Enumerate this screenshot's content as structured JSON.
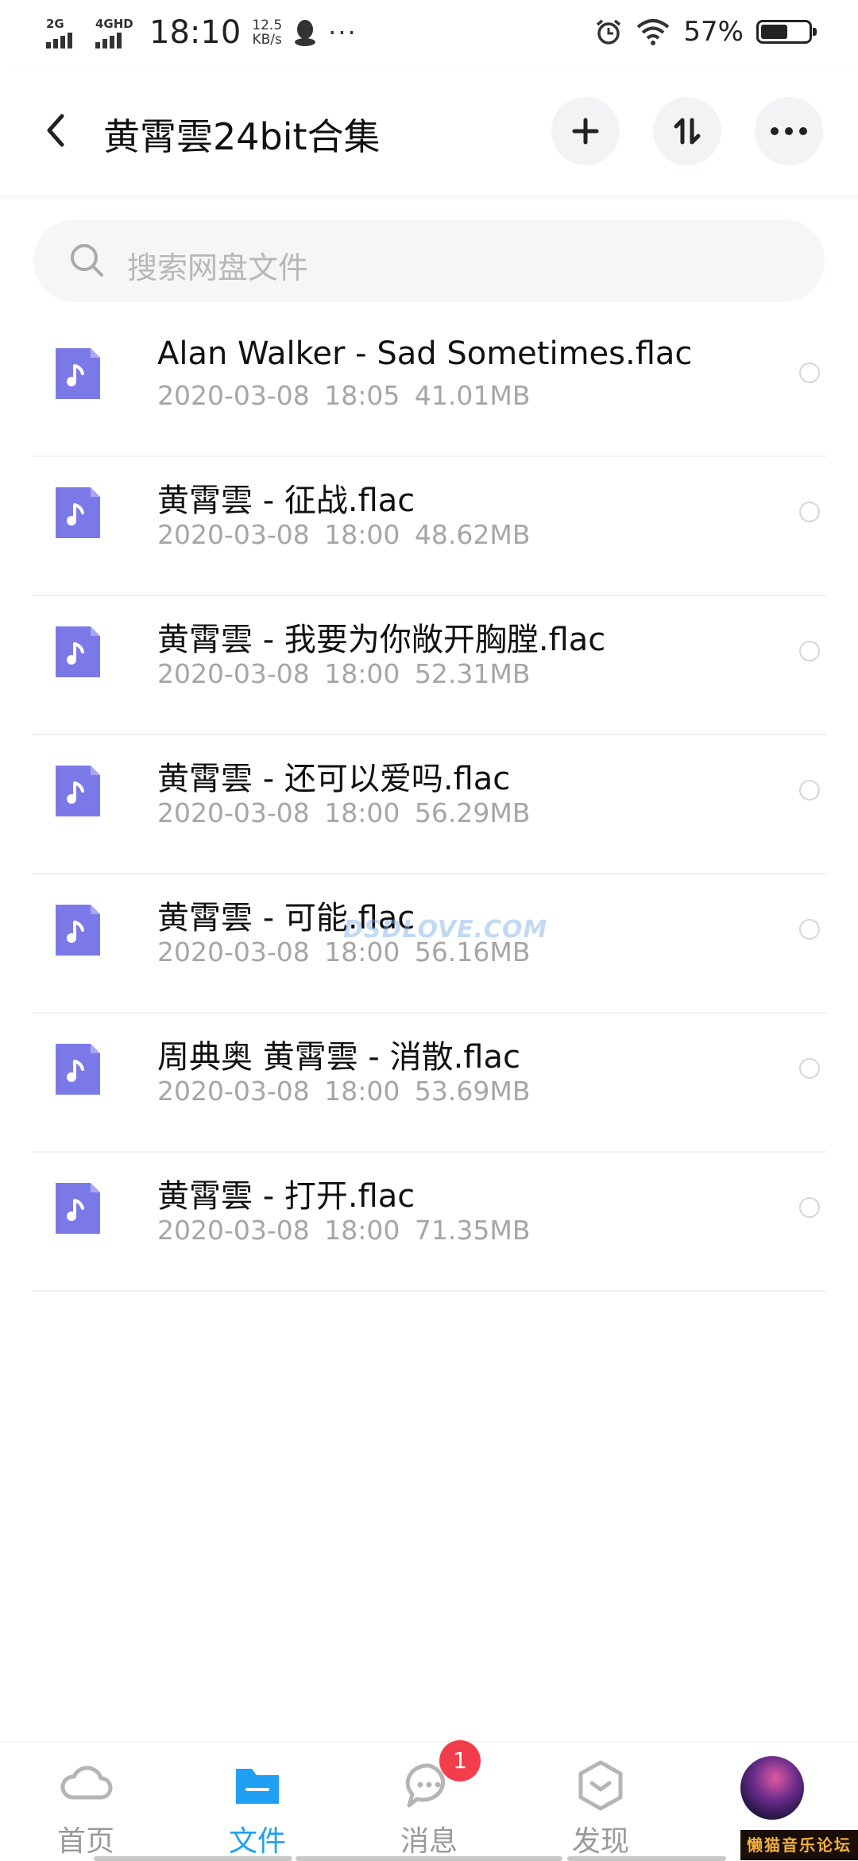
{
  "status_bar": {
    "sim1": "2G",
    "sim2": "4GHD",
    "time": "18:10",
    "speed_value": "12.5",
    "speed_unit": "KB/s",
    "more": "···",
    "battery_text": "57%",
    "battery_level": 0.57,
    "icons": [
      "signal-icon",
      "qq-icon",
      "alarm-icon",
      "wifi-icon",
      "battery-icon"
    ]
  },
  "header": {
    "title": "黄霄雲24bit合集",
    "buttons": [
      "back-icon",
      "plus-icon",
      "sort-icon",
      "more-icon"
    ]
  },
  "search": {
    "placeholder": "搜索网盘文件"
  },
  "files": [
    {
      "name": "Alan Walker - Sad Sometimes.flac",
      "date": "2020-03-08",
      "time": "18:05",
      "size": "41.01MB"
    },
    {
      "name": "黄霄雲 - 征战.flac",
      "date": "2020-03-08",
      "time": "18:00",
      "size": "48.62MB"
    },
    {
      "name": "黄霄雲 - 我要为你敞开胸膛.flac",
      "date": "2020-03-08",
      "time": "18:00",
      "size": "52.31MB"
    },
    {
      "name": "黄霄雲 - 还可以爱吗.flac",
      "date": "2020-03-08",
      "time": "18:00",
      "size": "56.29MB"
    },
    {
      "name": "黄霄雲 - 可能.flac",
      "date": "2020-03-08",
      "time": "18:00",
      "size": "56.16MB"
    },
    {
      "name": "周典奥 黄霄雲 - 消散.flac",
      "date": "2020-03-08",
      "time": "18:00",
      "size": "53.69MB"
    },
    {
      "name": "黄霄雲 - 打开.flac",
      "date": "2020-03-08",
      "time": "18:00",
      "size": "71.35MB"
    }
  ],
  "watermark": "DSDLOVE.COM",
  "bottom_nav": {
    "items": [
      {
        "label": "首页",
        "icon": "cloud-icon",
        "active": false
      },
      {
        "label": "文件",
        "icon": "folder-icon",
        "active": true
      },
      {
        "label": "消息",
        "icon": "chat-icon",
        "active": false,
        "badge": "1"
      },
      {
        "label": "发现",
        "icon": "discover-icon",
        "active": false
      }
    ],
    "avatar": "avatar"
  },
  "forum_tag": "懒猫音乐论坛",
  "colors": {
    "accent": "#1fa0f2",
    "file_icon": "#7b79e8",
    "badge": "#f23e4a",
    "meta_text": "#a6a6a6"
  }
}
